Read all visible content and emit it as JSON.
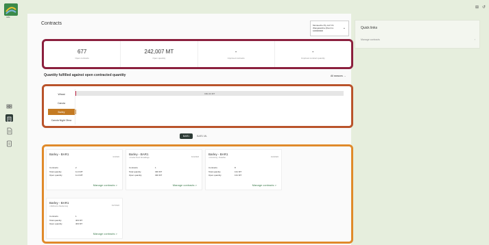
{
  "sidebar": {
    "logo_text": "cafe",
    "icons": [
      "grid-icon",
      "contract-icon",
      "document-icon",
      "clipboard-icon"
    ]
  },
  "topbar": {
    "grid_icon": "⊞",
    "refresh_icon": "↺"
  },
  "page": {
    "title": "Contracts"
  },
  "org_select": {
    "line1": "Monteeche Pty Ltd T/A",
    "line2": "Wangaratcha (Pest Co",
    "line3": "100000000",
    "chevron": "⌄"
  },
  "stats": [
    {
      "value": "677",
      "label": "Open contracts"
    },
    {
      "value": "242,007 MT",
      "label": "Open quantity"
    },
    {
      "value": "-",
      "label": "Unpriced contracts"
    },
    {
      "value": "-",
      "label": "Unpriced contract quantity"
    }
  ],
  "fulfilled": {
    "title": "Quantity fulfilled against open contracted quantity",
    "all_seasons": "All seasons →",
    "crops": [
      "Wheat",
      "Canola",
      "Barley",
      "Canola Night Ohno"
    ],
    "active_crop_index": 2,
    "bar_label": "CRL/13 MT"
  },
  "unit_toggle": {
    "on": "BAR1",
    "off": "BAR1 ML"
  },
  "cards": [
    {
      "title": "Barley - BAR1",
      "location": "",
      "date": "3/1/2022",
      "contracts": "2",
      "total": "11.0 MT",
      "open": "11.0 MT",
      "link": "Manage contracts >"
    },
    {
      "title": "Barley - BAR1",
      "location": "• Amelia Fresh Donaldinga",
      "date": "3/21/2023",
      "contracts": "1",
      "total": "336 MT",
      "open": "336 MT",
      "link": "Manage contracts >"
    },
    {
      "title": "Barley - BAR1",
      "location": "• Armstrong - Rodelfse",
      "date": "2/24/2022",
      "contracts": "8",
      "total": "131 MT",
      "open": "131 MT",
      "link": "Manage contracts >"
    },
    {
      "title": "Barley - BAR1",
      "location": "• Melbourne Dandenong",
      "date": "3/27/2023",
      "contracts": "1",
      "total": "403 MT",
      "open": "403 MT",
      "link": "Manage contracts >"
    }
  ],
  "card_labels": {
    "contracts": "Contracts",
    "total": "Total quantity",
    "open": "Open quantity"
  },
  "quick_links": {
    "title": "Quick links",
    "item": "Manage contracts",
    "chevron": "›"
  },
  "colors": {
    "stats_border": "#8b1f3d",
    "crops_border": "#b9532a",
    "cards_border": "#e08a2a",
    "active_crop": "#c47a22",
    "link_green": "#3a7a4a"
  }
}
